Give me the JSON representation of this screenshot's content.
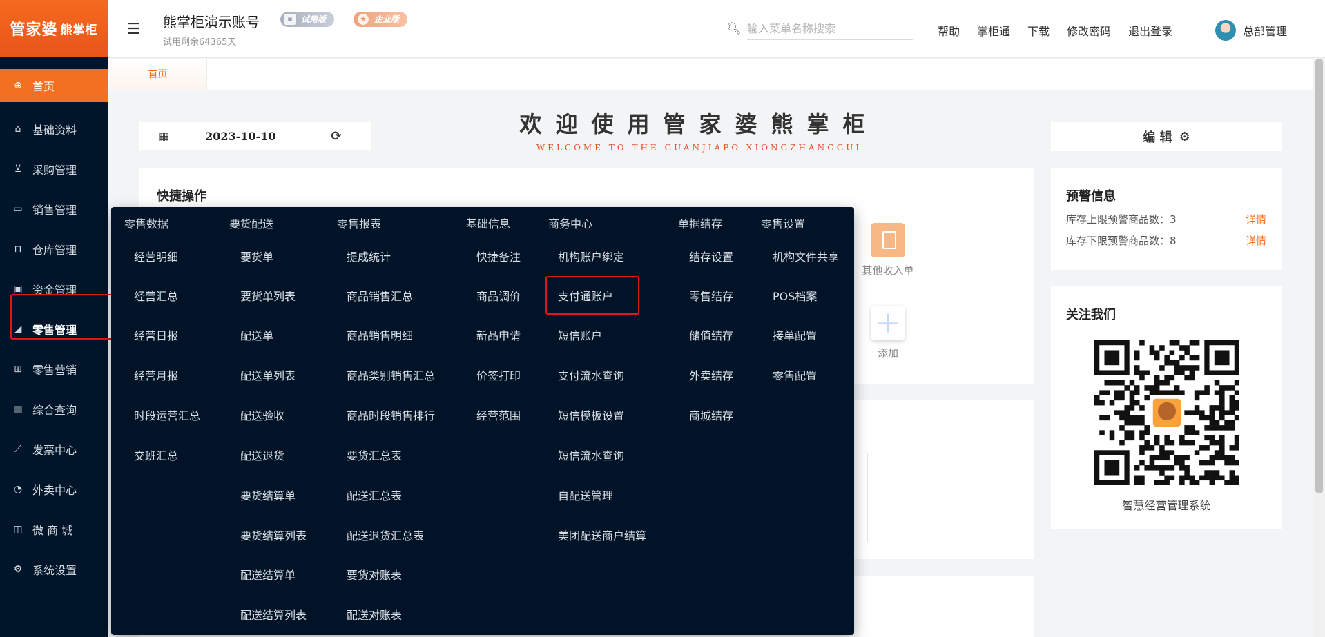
{
  "sidebar": {
    "logo": "管家婆",
    "logo_small": "熊掌柜",
    "items": [
      {
        "label": "首页",
        "icon": "globe-icon"
      },
      {
        "label": "基础资料",
        "icon": "home-icon"
      },
      {
        "label": "采购管理",
        "icon": "cart-icon"
      },
      {
        "label": "销售管理",
        "icon": "card-icon"
      },
      {
        "label": "仓库管理",
        "icon": "bank-icon"
      },
      {
        "label": "资金管理",
        "icon": "money-icon"
      },
      {
        "label": "零售管理",
        "icon": "chart-area-icon"
      },
      {
        "label": "零售营销",
        "icon": "gift-icon"
      },
      {
        "label": "综合查询",
        "icon": "bar-chart-icon"
      },
      {
        "label": "发票中心",
        "icon": "line-chart-icon"
      },
      {
        "label": "外卖中心",
        "icon": "delivery-icon"
      },
      {
        "label": "微 商 城",
        "icon": "bag-icon"
      },
      {
        "label": "系统设置",
        "icon": "gear-icon"
      }
    ]
  },
  "header": {
    "title": "熊掌柜演示账号",
    "subtitle": "试用剩余64365天",
    "badge_trial": "试用版",
    "badge_enterprise": "企业版",
    "search_placeholder": "输入菜单名称搜索",
    "links": [
      "帮助",
      "掌柜通",
      "下载",
      "修改密码",
      "退出登录"
    ],
    "user": "总部管理"
  },
  "tabs": [
    {
      "label": "首页"
    }
  ],
  "main": {
    "date": "2023-10-10",
    "welcome_cn": "欢迎使用管家婆熊掌柜",
    "welcome_en": "WELCOME TO THE GUANJIAPO XIONGZHANGGUI",
    "edit_label": "编 辑",
    "quick_title": "快捷操作",
    "quick_items": [
      "其他收入单",
      "添加"
    ]
  },
  "warning": {
    "title": "预警信息",
    "rows": [
      {
        "label": "库存上限预警商品数：3",
        "link": "详情"
      },
      {
        "label": "库存下限预警商品数：8",
        "link": "详情"
      }
    ]
  },
  "follow": {
    "title": "关注我们",
    "caption": "智慧经营管理系统"
  },
  "menu": {
    "columns": [
      {
        "head": "零售数据",
        "items": [
          "经营明细",
          "经营汇总",
          "经营日报",
          "经营月报",
          "时段运营汇总",
          "交班汇总"
        ]
      },
      {
        "head": "要货配送",
        "items": [
          "要货单",
          "要货单列表",
          "配送单",
          "配送单列表",
          "配送验收",
          "配送退货",
          "要货结算单",
          "要货结算列表",
          "配送结算单",
          "配送结算列表"
        ]
      },
      {
        "head": "零售报表",
        "items": [
          "提成统计",
          "商品销售汇总",
          "商品销售明细",
          "商品类别销售汇总",
          "商品时段销售排行",
          "要货汇总表",
          "配送汇总表",
          "配送退货汇总表",
          "要货对账表",
          "配送对账表"
        ]
      },
      {
        "head": "基础信息",
        "items": [
          "快捷备注",
          "商品调价",
          "新品申请",
          "价签打印",
          "经营范围"
        ]
      },
      {
        "head": "商务中心",
        "items": [
          "机构账户绑定",
          "支付通账户",
          "短信账户",
          "支付流水查询",
          "短信模板设置",
          "短信流水查询",
          "自配送管理",
          "美团配送商户结算"
        ]
      },
      {
        "head": "单据结存",
        "items": [
          "结存设置",
          "零售结存",
          "储值结存",
          "外卖结存",
          "商城结存"
        ]
      },
      {
        "head": "零售设置",
        "items": [
          "机构文件共享",
          "POS档案",
          "接单配置",
          "零售配置"
        ]
      }
    ]
  }
}
